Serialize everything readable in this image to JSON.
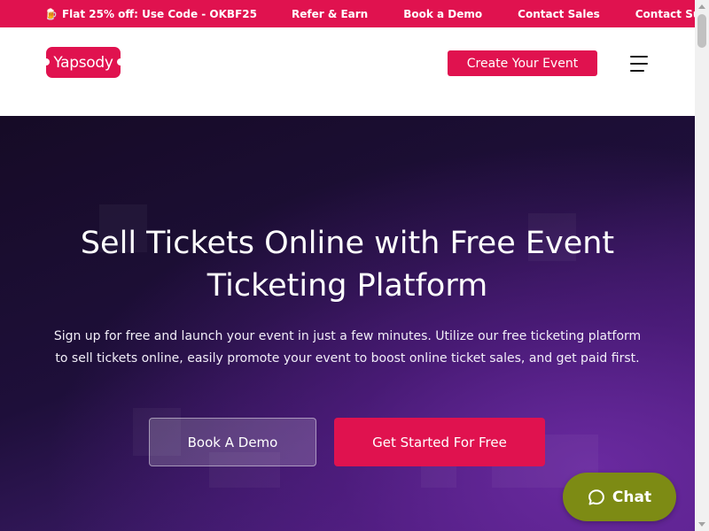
{
  "topbar": {
    "promo_emoji": "🍺",
    "promo_text": "Flat 25% off: Use Code - OKBF25",
    "links": [
      "Refer & Earn",
      "Book a Demo",
      "Contact Sales",
      "Contact Support"
    ]
  },
  "header": {
    "logo_text": "Yapsody",
    "create_event_label": "Create Your Event",
    "menu_icon": "hamburger-menu-icon"
  },
  "hero": {
    "title_line1": "Sell Tickets Online with Free Event",
    "title_line2": "Ticketing Platform",
    "subtitle": "Sign up for free and launch your event in just a few minutes. Utilize our free ticketing platform to sell tickets online, easily promote your event to boost online ticket sales, and get paid first.",
    "book_demo_label": "Book A Demo",
    "get_started_label": "Get Started For Free"
  },
  "chat": {
    "label": "Chat",
    "icon": "chat-bubble-icon"
  },
  "colors": {
    "brand": "#e0124f",
    "chat": "#7d8b14",
    "hero_dark": "#160b26",
    "hero_purple": "#5c2590"
  }
}
